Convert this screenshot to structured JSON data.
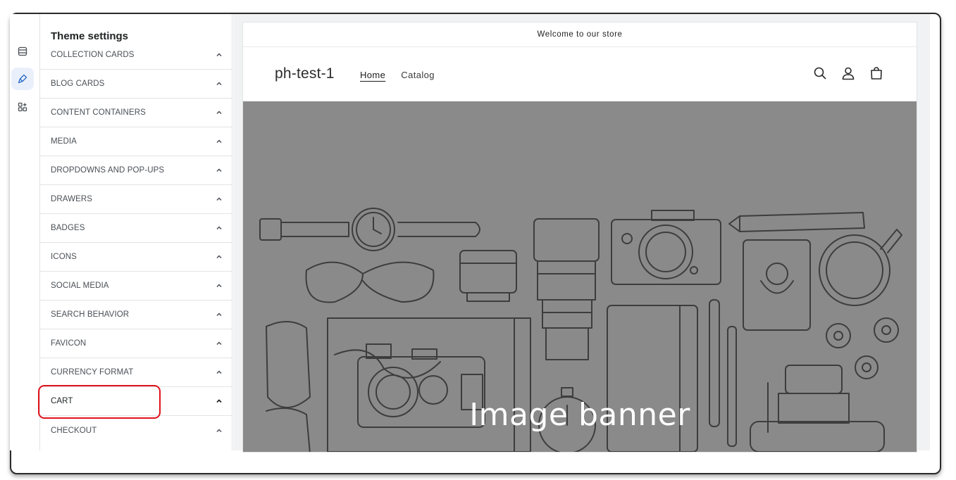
{
  "sidebar": {
    "title": "Theme settings",
    "sections": [
      {
        "label": "COLLECTION CARDS"
      },
      {
        "label": "BLOG CARDS"
      },
      {
        "label": "CONTENT CONTAINERS"
      },
      {
        "label": "MEDIA"
      },
      {
        "label": "DROPDOWNS AND POP-UPS"
      },
      {
        "label": "DRAWERS"
      },
      {
        "label": "BADGES"
      },
      {
        "label": "ICONS"
      },
      {
        "label": "SOCIAL MEDIA"
      },
      {
        "label": "SEARCH BEHAVIOR"
      },
      {
        "label": "FAVICON"
      },
      {
        "label": "CURRENCY FORMAT"
      },
      {
        "label": "CART"
      },
      {
        "label": "CHECKOUT"
      }
    ]
  },
  "rail": {
    "icons": [
      "sections-icon",
      "theme-settings-brush-icon",
      "app-blocks-icon"
    ]
  },
  "store": {
    "announcement": "Welcome to our store",
    "brand": "ph-test-1",
    "nav": [
      {
        "label": "Home",
        "current": true
      },
      {
        "label": "Catalog",
        "current": false
      }
    ],
    "header_icons": [
      "search-icon",
      "account-icon",
      "cart-icon"
    ],
    "banner_title": "Image banner"
  },
  "colors": {
    "highlight": "#e0131b",
    "banner_bg": "#8a8a8a",
    "rail_active": "#eaf0fb"
  }
}
